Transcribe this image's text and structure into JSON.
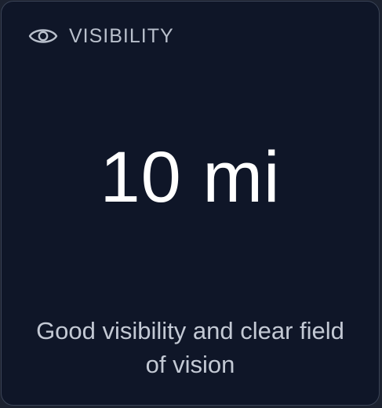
{
  "card": {
    "title": "VISIBILITY",
    "icon": "eye-icon",
    "value": "10 mi",
    "description": "Good visibility and clear field of vision"
  },
  "colors": {
    "background": "#0f1628",
    "border": "#3a4356",
    "title": "#b9c0cc",
    "value": "#ffffff",
    "description": "#c3c9d4"
  }
}
